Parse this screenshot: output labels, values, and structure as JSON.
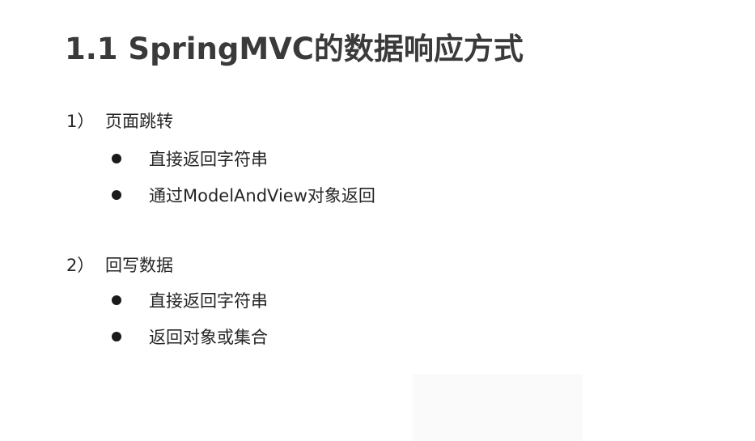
{
  "title": "1.1 SpringMVC的数据响应方式",
  "sections": [
    {
      "number": "1）",
      "heading": "页面跳转",
      "bullets": [
        "直接返回字符串",
        "通过ModelAndView对象返回"
      ]
    },
    {
      "number": "2）",
      "heading": "回写数据",
      "bullets": [
        "直接返回字符串",
        "返回对象或集合"
      ]
    }
  ]
}
